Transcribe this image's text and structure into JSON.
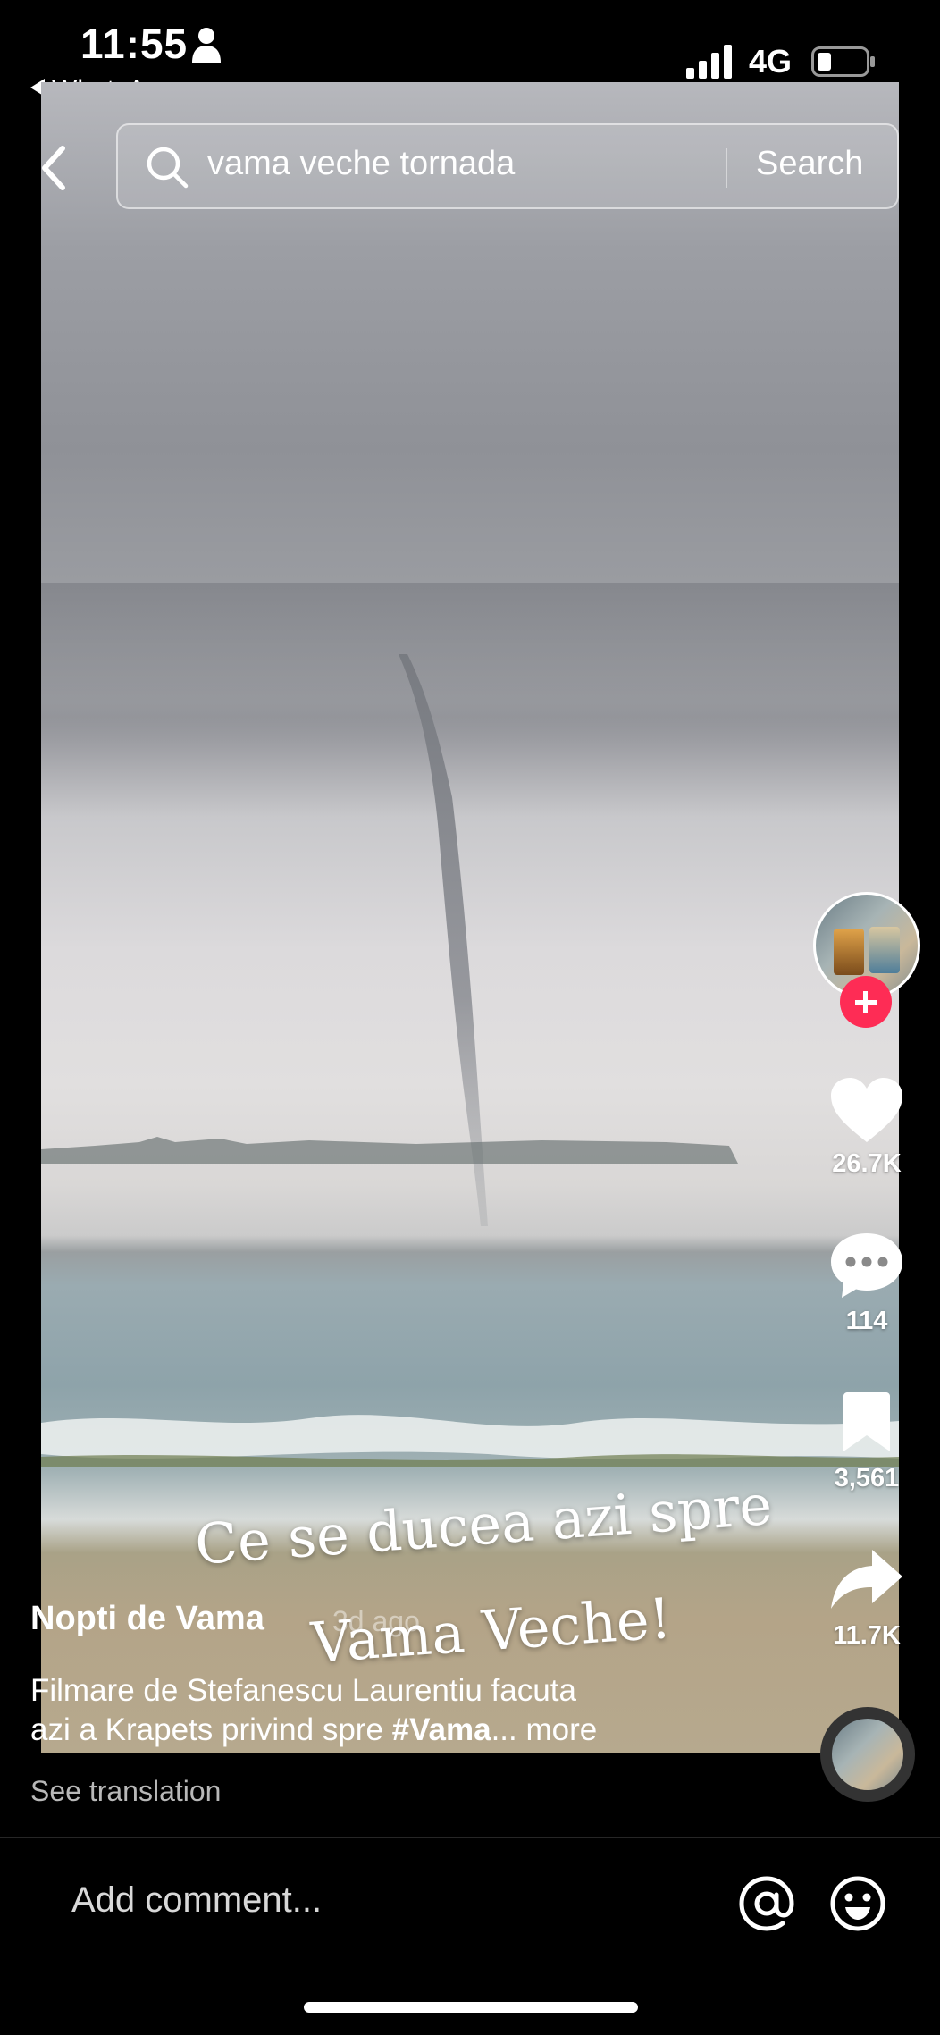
{
  "status_bar": {
    "time": "11:55",
    "back_app": "WhatsApp",
    "network": "4G"
  },
  "search": {
    "query": "vama veche tornada",
    "button_label": "Search"
  },
  "video": {
    "caption_line1": "Ce se ducea azi spre",
    "caption_line2": "Vama Veche!"
  },
  "actions": {
    "likes": "26.7K",
    "comments": "114",
    "saves": "3,561",
    "shares": "11.7K"
  },
  "post": {
    "author": "Nopti de Vama",
    "posted_ago": "3d ago",
    "description_line1": "Filmare de Stefanescu Laurentiu facuta",
    "description_line2_prefix": "azi a Krapets privind spre ",
    "hashtag": "#Vama",
    "ellipsis": "...",
    "more_label": " more",
    "see_translation": "See translation"
  },
  "comment_bar": {
    "placeholder": "Add comment..."
  },
  "colors": {
    "accent_red": "#fe2c55",
    "background": "#000000"
  }
}
